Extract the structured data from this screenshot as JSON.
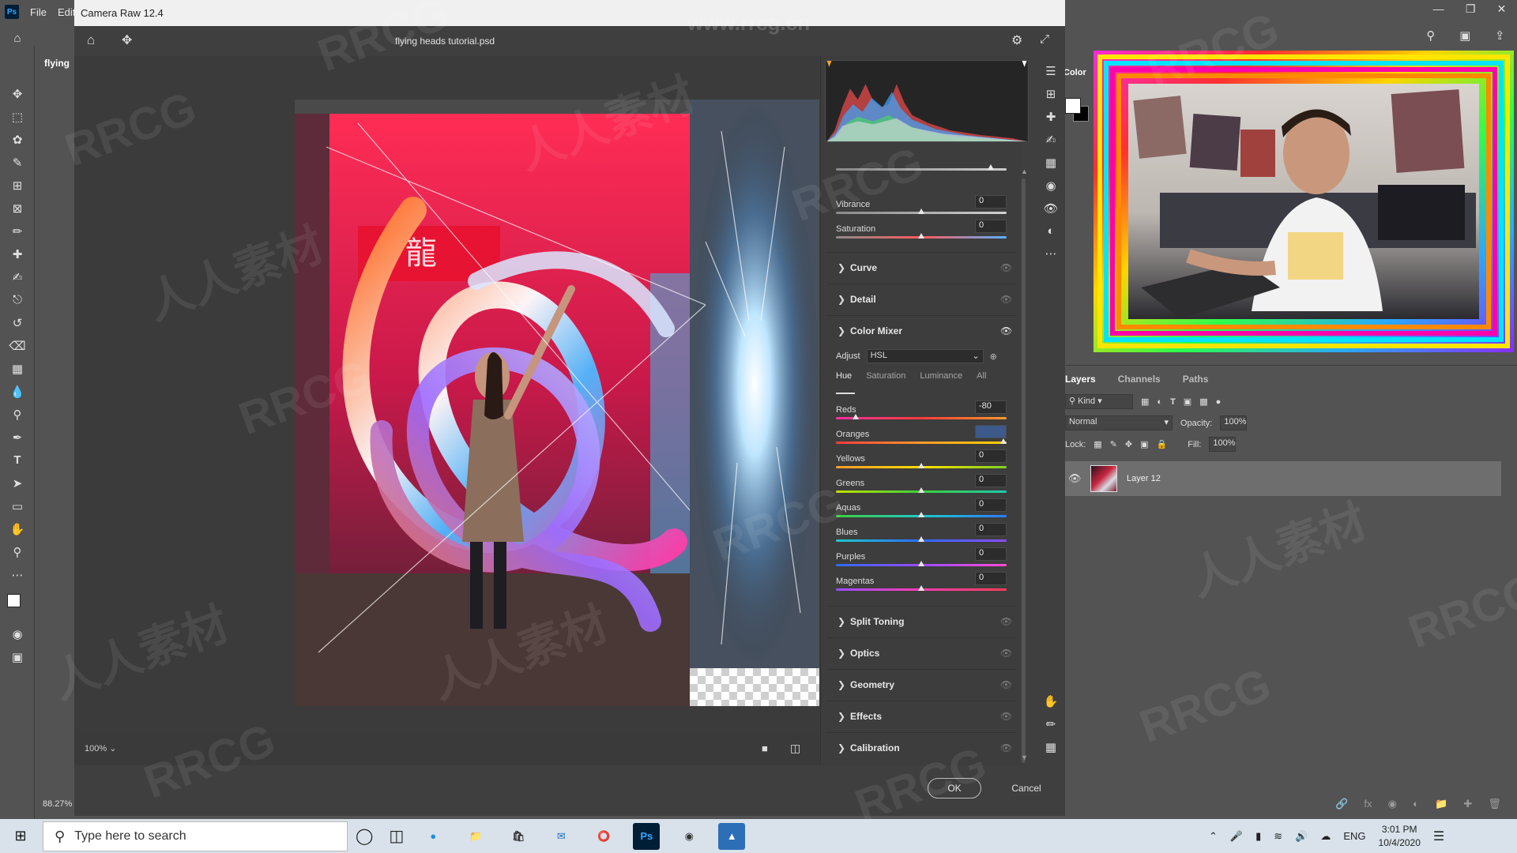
{
  "ps": {
    "menu": [
      "File",
      "Edit"
    ],
    "doc_tab": "flying",
    "zoom_status": "88.27%",
    "color_tab": "Color",
    "layers": {
      "tabs": [
        "Layers",
        "Channels",
        "Paths"
      ],
      "kind_label": "Kind",
      "blend_mode": "Normal",
      "opacity_label": "Opacity:",
      "opacity_value": "100%",
      "lock_label": "Lock:",
      "fill_label": "Fill:",
      "fill_value": "100%",
      "layer_name": "Layer 12"
    }
  },
  "camera_raw": {
    "title": "Camera Raw 12.4",
    "filename": "flying heads tutorial.psd",
    "zoom": "100%",
    "ok": "OK",
    "cancel": "Cancel",
    "top_sliders": [
      {
        "label": "Vibrance",
        "value": "0"
      },
      {
        "label": "Saturation",
        "value": "0"
      }
    ],
    "sections_top": [
      "Curve",
      "Detail"
    ],
    "color_mixer": {
      "title": "Color Mixer",
      "adjust_label": "Adjust",
      "adjust_value": "HSL",
      "tabs": [
        "Hue",
        "Saturation",
        "Luminance",
        "All"
      ],
      "sliders": [
        {
          "label": "Reds",
          "value": "-80",
          "level": -80
        },
        {
          "label": "Oranges",
          "value": "",
          "level": 100
        },
        {
          "label": "Yellows",
          "value": "0",
          "level": 0
        },
        {
          "label": "Greens",
          "value": "0",
          "level": 0
        },
        {
          "label": "Aquas",
          "value": "0",
          "level": 0
        },
        {
          "label": "Blues",
          "value": "0",
          "level": 0
        },
        {
          "label": "Purples",
          "value": "0",
          "level": 0
        },
        {
          "label": "Magentas",
          "value": "0",
          "level": 0
        }
      ]
    },
    "sections_bottom": [
      "Split Toning",
      "Optics",
      "Geometry",
      "Effects",
      "Calibration"
    ]
  },
  "taskbar": {
    "search_placeholder": "Type here to search",
    "lang": "ENG",
    "time": "3:01 PM",
    "date": "10/4/2020"
  },
  "watermarks": [
    "RRCG",
    "人人素材",
    "www.rrcg.cn"
  ]
}
